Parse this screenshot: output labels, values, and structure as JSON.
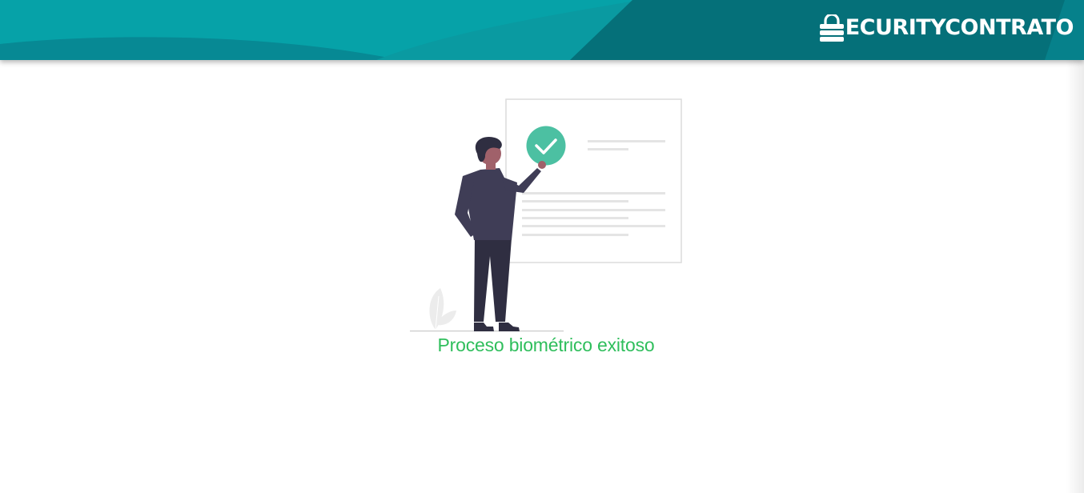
{
  "header": {
    "brand_text": "ECURITYCONTRATO",
    "brand_icon": "padlock-s-icon",
    "colors": {
      "teal_light": "#05a0a6",
      "teal_mid": "#078f98",
      "teal_dark": "#056c78"
    }
  },
  "main": {
    "status_message": "Proceso biométrico exitoso",
    "status_color": "#2fbe5c",
    "illustration": "person-verifying-document-illustration"
  }
}
